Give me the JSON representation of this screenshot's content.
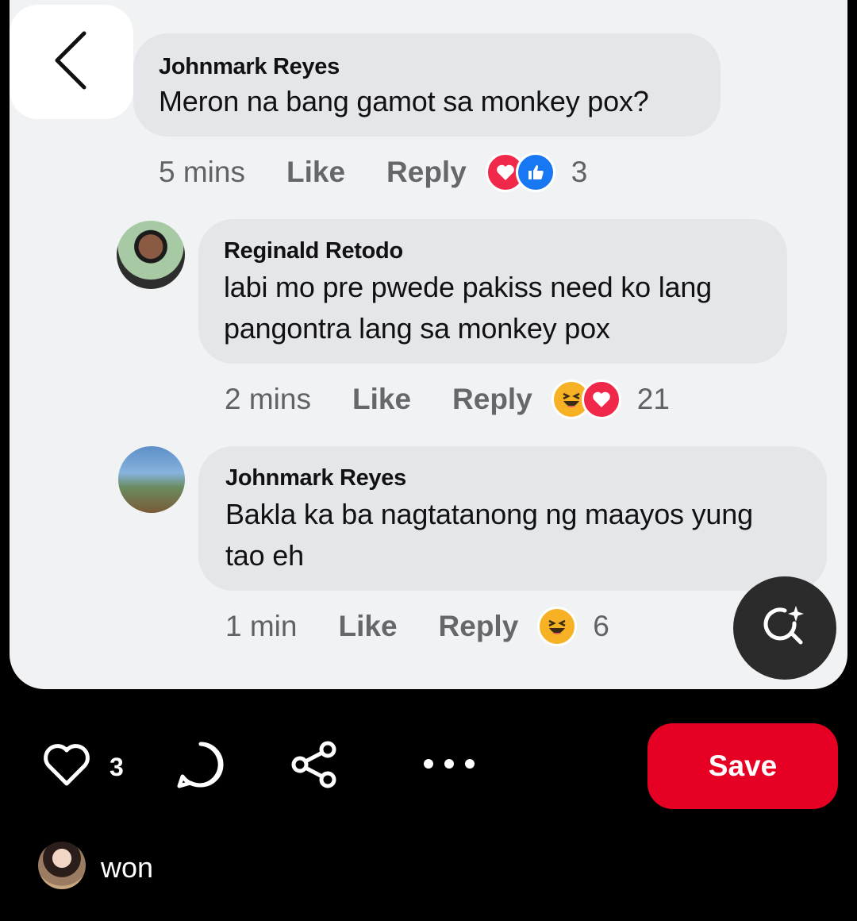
{
  "pin": {
    "comments": [
      {
        "author": "Johnmark Reyes",
        "text": "Meron na bang gamot sa monkey pox?",
        "time": "5 mins",
        "like_label": "Like",
        "reply_label": "Reply",
        "reactions": [
          "love",
          "like"
        ],
        "reaction_count": "3"
      },
      {
        "author": "Reginald Retodo",
        "text_lines": [
          "labi mo pre pwede pakiss need ko lang",
          "pangontra lang sa monkey pox"
        ],
        "time": "2 mins",
        "like_label": "Like",
        "reply_label": "Reply",
        "reactions": [
          "haha",
          "love"
        ],
        "reaction_count": "21"
      },
      {
        "author": "Johnmark Reyes",
        "text_lines": [
          "Bakla ka ba nagtatanong ng maayos yung",
          "tao eh"
        ],
        "time": "1 min",
        "like_label": "Like",
        "reply_label": "Reply",
        "reactions": [
          "haha"
        ],
        "reaction_count": "6"
      }
    ]
  },
  "toolbar": {
    "like_count": "3",
    "save_label": "Save"
  },
  "creator": {
    "name": "won"
  },
  "icons": [
    "back-arrow-icon",
    "visual-search-icon",
    "heart-icon",
    "comment-icon",
    "share-icon",
    "more-icon"
  ],
  "colors": {
    "save": "#e60023",
    "bubble": "#e4e6ea",
    "love": "#f0284a",
    "like": "#1877f2",
    "haha": "#f7b125"
  }
}
